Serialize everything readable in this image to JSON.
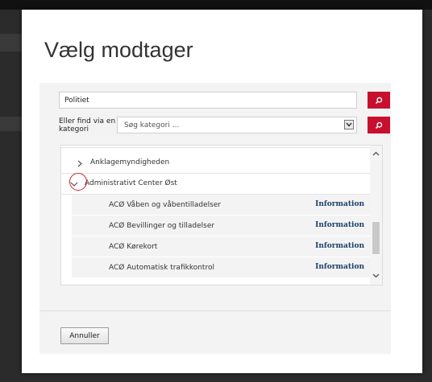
{
  "modal": {
    "title": "Vælg modtager"
  },
  "search": {
    "value": "Politiet"
  },
  "category": {
    "label": "Eller find via en kategori",
    "placeholder": "Søg kategori ..."
  },
  "tree": {
    "items": [
      {
        "label": "Anklagemyndigheden",
        "expanded": false
      },
      {
        "label": "Administrativt Center Øst",
        "expanded": true
      }
    ],
    "subitems": [
      {
        "label": "ACØ Våben og våbentilladelser",
        "link": "Information"
      },
      {
        "label": "ACØ Bevillinger og tilladelser",
        "link": "Information"
      },
      {
        "label": "ACØ Kørekort",
        "link": "Information"
      },
      {
        "label": "ACØ Automatisk trafikkontrol",
        "link": "Information"
      }
    ]
  },
  "footer": {
    "cancel_label": "Annuller"
  },
  "colors": {
    "accent": "#c8102e",
    "link": "#1a3f68",
    "annotation": "#d0202a"
  }
}
